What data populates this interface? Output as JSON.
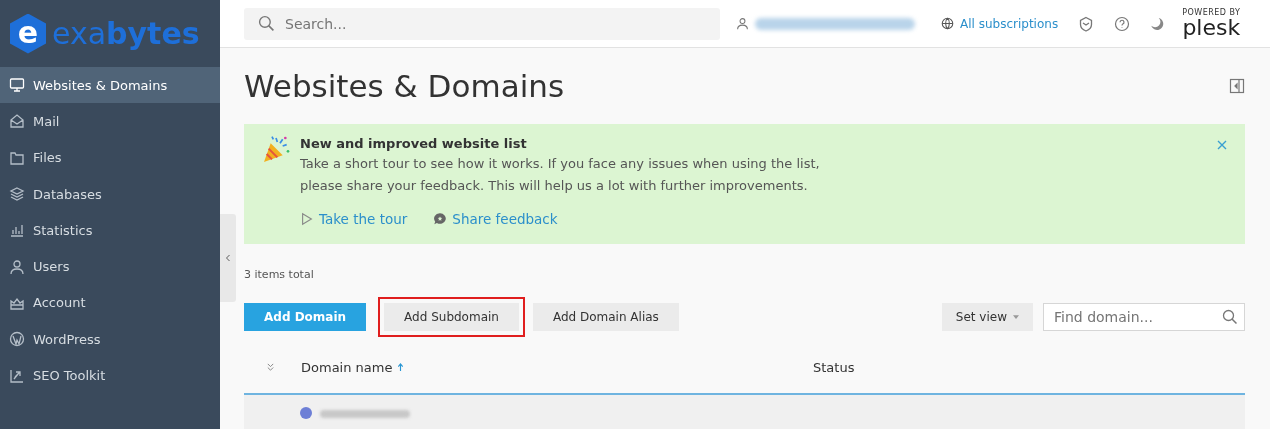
{
  "logo": {
    "badge": "e",
    "wordmark": "exa**bytes**"
  },
  "sidebar": {
    "items": [
      {
        "label": "Websites & Domains",
        "selected": true
      },
      {
        "label": "Mail",
        "selected": false
      },
      {
        "label": "Files",
        "selected": false
      },
      {
        "label": "Databases",
        "selected": false
      },
      {
        "label": "Statistics",
        "selected": false
      },
      {
        "label": "Users",
        "selected": false
      },
      {
        "label": "Account",
        "selected": false
      },
      {
        "label": "WordPress",
        "selected": false
      },
      {
        "label": "SEO Toolkit",
        "selected": false
      }
    ]
  },
  "header": {
    "search": {
      "placeholder": "Search..."
    },
    "subscriptions": "All subscriptions",
    "brand": {
      "tagline": "POWERED BY",
      "name": "plesk"
    }
  },
  "page": {
    "title": "Websites & Domains"
  },
  "notice": {
    "title": "New and improved website list",
    "body": "Take a short tour to see how it works. If you face any issues when using the list,\nplease share your feedback. This will help us a lot with further improvements.",
    "links": [
      {
        "label": "Take the tour"
      },
      {
        "label": "Share feedback"
      }
    ]
  },
  "total": "3 items total",
  "toolbar": {
    "buttons": [
      {
        "label": "Add Domain",
        "kind": "primary",
        "highlighted": false
      },
      {
        "label": "Add Subdomain",
        "kind": "plain",
        "highlighted": true
      },
      {
        "label": "Add Domain Alias",
        "kind": "plain",
        "highlighted": false
      }
    ],
    "set_view": "Set view",
    "find": {
      "placeholder": "Find domain..."
    }
  },
  "table": {
    "columns": [
      {
        "label": "Domain name",
        "sorted": true
      },
      {
        "label": "Status",
        "sorted": false
      }
    ]
  }
}
